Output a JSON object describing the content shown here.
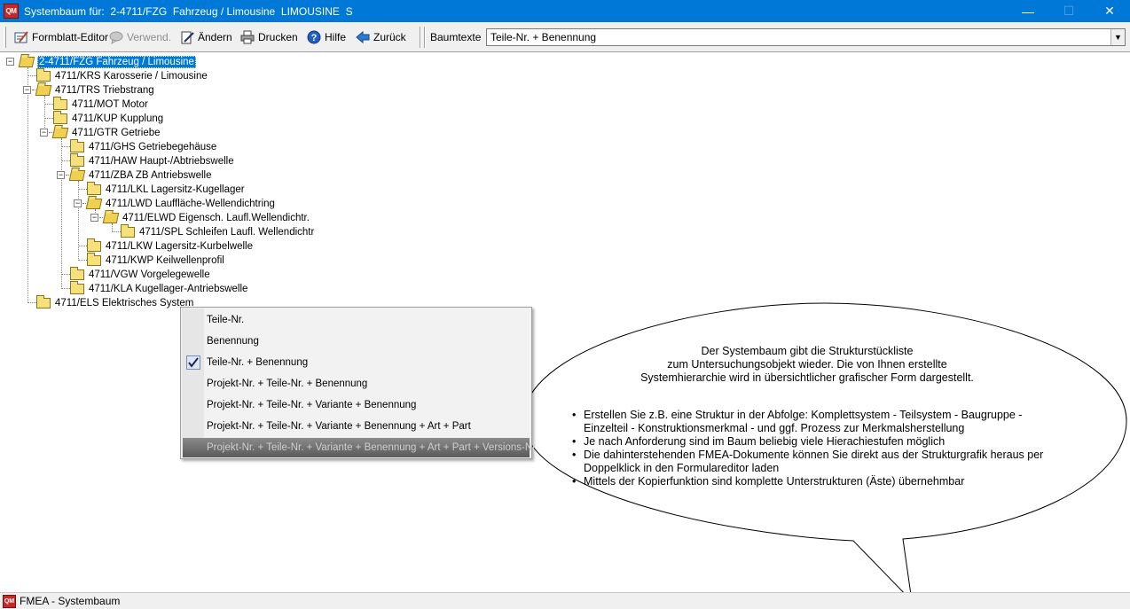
{
  "window": {
    "title": "Systembaum für:  2-4711/FZG  Fahrzeug / Limousine  LIMOUSINE  S",
    "app_icon_text": "QM",
    "minimize": "—",
    "maximize": "☐",
    "close": "✕"
  },
  "toolbar": {
    "formblatt_editor": "Formblatt-Editor",
    "verwend": "Verwend.",
    "aendern": "Ändern",
    "drucken": "Drucken",
    "hilfe": "Hilfe",
    "zurueck": "Zurück",
    "baumtexte_label": "Baumtexte",
    "baumtexte_value": "Teile-Nr. + Benennung"
  },
  "tree": {
    "nodes": [
      {
        "id": "2-4711/FZG",
        "label": "2-4711/FZG  Fahrzeug / Limousine",
        "selected": true
      },
      {
        "id": "4711/KRS",
        "label": "4711/KRS  Karosserie / Limousine"
      },
      {
        "id": "4711/TRS",
        "label": "4711/TRS  Triebstrang"
      },
      {
        "id": "4711/MOT",
        "label": "4711/MOT  Motor"
      },
      {
        "id": "4711/KUP",
        "label": "4711/KUP  Kupplung"
      },
      {
        "id": "4711/GTR",
        "label": "4711/GTR  Getriebe"
      },
      {
        "id": "4711/GHS",
        "label": "4711/GHS  Getriebegehäuse"
      },
      {
        "id": "4711/HAW",
        "label": "4711/HAW  Haupt-/Abtriebswelle"
      },
      {
        "id": "4711/ZBA",
        "label": "4711/ZBA  ZB Antriebswelle"
      },
      {
        "id": "4711/LKL",
        "label": "4711/LKL  Lagersitz-Kugellager"
      },
      {
        "id": "4711/LWD",
        "label": "4711/LWD  Lauffläche-Wellendichtring"
      },
      {
        "id": "4711/ELWD",
        "label": "4711/ELWD  Eigensch. Laufl.Wellendichtr."
      },
      {
        "id": "4711/SPL",
        "label": "4711/SPL  Schleifen Laufl. Wellendichtr"
      },
      {
        "id": "4711/LKW",
        "label": "4711/LKW  Lagersitz-Kurbelwelle"
      },
      {
        "id": "4711/KWP",
        "label": "4711/KWP  Keilwellenprofil"
      },
      {
        "id": "4711/VGW",
        "label": "4711/VGW  Vorgelegewelle"
      },
      {
        "id": "4711/KLA",
        "label": "4711/KLA  Kugellager-Antriebswelle"
      },
      {
        "id": "4711/ELS",
        "label": "4711/ELS  Elektrisches System"
      }
    ]
  },
  "context_menu": {
    "items": [
      {
        "label": "Teile-Nr."
      },
      {
        "label": "Benennung"
      },
      {
        "label": "Teile-Nr. + Benennung",
        "checked": true
      },
      {
        "label": "Projekt-Nr. + Teile-Nr. + Benennung"
      },
      {
        "label": "Projekt-Nr. + Teile-Nr. + Variante + Benennung"
      },
      {
        "label": "Projekt-Nr. + Teile-Nr. + Variante + Benennung + Art + Part"
      },
      {
        "label": "Projekt-Nr. + Teile-Nr. + Variante + Benennung + Art + Part + Versions-Nr.",
        "highlighted": true
      }
    ]
  },
  "callout": {
    "intro_line1": "Der Systembaum gibt die Strukturstückliste",
    "intro_line2": "zum Untersuchungsobjekt wieder. Die von Ihnen erstellte",
    "intro_line3": "Systemhierarchie wird in übersichtlicher grafischer Form dargestellt.",
    "bullets": [
      "Erstellen Sie z.B. eine Struktur in der Abfolge: Komplettsystem - Teilsystem - Baugruppe - Einzelteil - Konstruktionsmerkmal - und ggf. Prozess zur Merkmalsherstellung",
      "Je nach Anforderung sind im Baum beliebig viele Hierachiestufen möglich",
      "Die dahinterstehenden FMEA-Dokumente können Sie direkt aus der Strukturgrafik heraus per Doppelklick in den Formulareditor laden",
      "Mittels der Kopierfunktion sind komplette Unterstrukturen (Äste) übernehmbar"
    ]
  },
  "statusbar": {
    "text": "FMEA - Systembaum"
  },
  "colors": {
    "titlebar": "#0078d7",
    "selection": "#0078d7",
    "folder": "#f5e07a"
  }
}
